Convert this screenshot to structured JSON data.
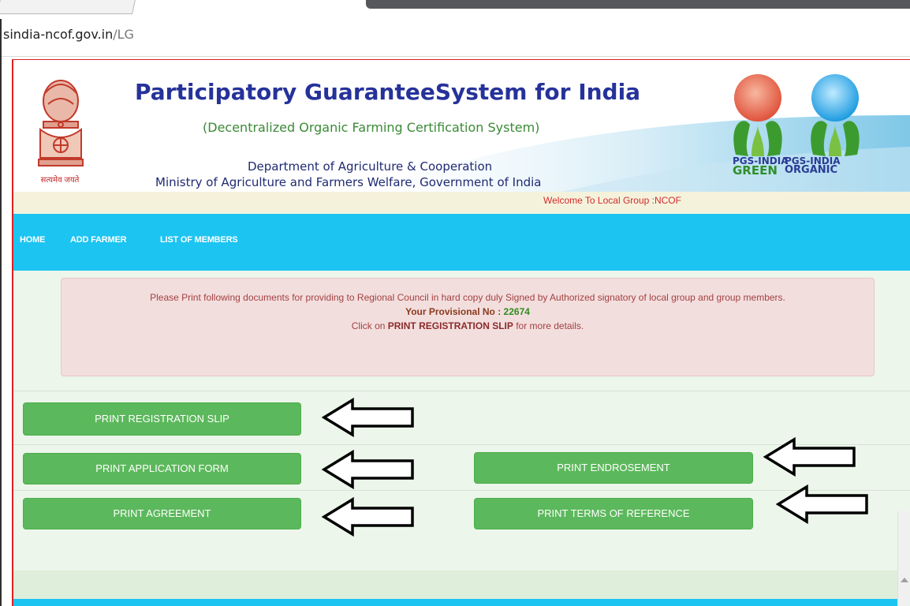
{
  "browser": {
    "url_host": "sindia-ncof.gov.in",
    "url_path": "/LG"
  },
  "header": {
    "emblem_caption": "सत्यमेव जयते",
    "title": "Participatory GuaranteeSystem for India",
    "subtitle": "(Decentralized Organic Farming Certification System)",
    "department": "Department of Agriculture & Cooperation",
    "ministry": "Ministry of Agriculture and Farmers Welfare, Government of India",
    "logo_green": {
      "line1": "PGS-INDIA",
      "line2": "GREEN"
    },
    "logo_organic": {
      "line1": "PGS-INDIA",
      "line2": "ORGANIC"
    },
    "welcome": "Welcome To Local Group :NCOF"
  },
  "nav": {
    "items": [
      {
        "label": "HOME"
      },
      {
        "label": "ADD FARMER"
      },
      {
        "label": "LIST OF MEMBERS"
      }
    ]
  },
  "alert": {
    "line1": "Please Print following documents for providing to Regional Council in hard copy duly Signed by Authorized signatory of local group and group members.",
    "prov_label": "Your Provisional No : ",
    "prov_number": "22674",
    "click_prefix": "Click on ",
    "click_strong": "PRINT REGISTRATION SLIP",
    "click_suffix": " for more details."
  },
  "buttons": {
    "slip": "PRINT REGISTRATION SLIP",
    "application": "PRINT APPLICATION FORM",
    "endrosement": "PRINT ENDROSEMENT",
    "agreement": "PRINT AGREEMENT",
    "terms": "PRINT TERMS OF REFERENCE"
  },
  "colors": {
    "title": "#26329a",
    "nav": "#1cc4f1",
    "button": "#5cb85c",
    "alert_bg": "#f3dede",
    "page_bg": "#ecf6ea"
  }
}
